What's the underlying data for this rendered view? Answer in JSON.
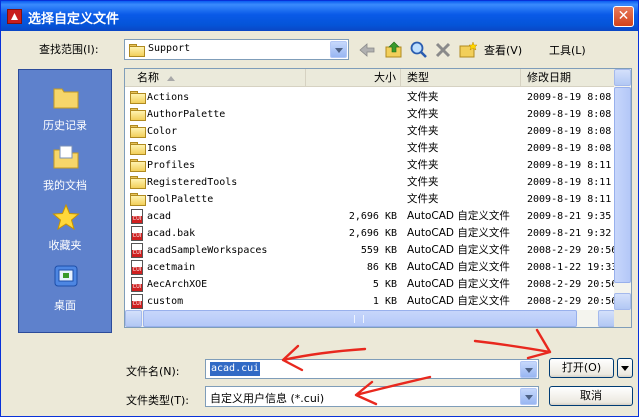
{
  "window": {
    "title": "选择自定义文件"
  },
  "lookin": {
    "label": "查找范围(I):",
    "value": "Support"
  },
  "toolbar": {
    "view_label": "查看(V)",
    "tools_label": "工具(L)"
  },
  "places": [
    {
      "label": "历史记录",
      "icon": "history-folder-icon"
    },
    {
      "label": "我的文档",
      "icon": "documents-folder-icon"
    },
    {
      "label": "收藏夹",
      "icon": "star-icon"
    },
    {
      "label": "桌面",
      "icon": "desktop-icon"
    }
  ],
  "columns": {
    "name": "名称",
    "size": "大小",
    "type": "类型",
    "date": "修改日期"
  },
  "files": [
    {
      "name": "Actions",
      "size": "",
      "type": "文件夹",
      "date": "2009-8-19 8:08",
      "kind": "folder"
    },
    {
      "name": "AuthorPalette",
      "size": "",
      "type": "文件夹",
      "date": "2009-8-19 8:08",
      "kind": "folder"
    },
    {
      "name": "Color",
      "size": "",
      "type": "文件夹",
      "date": "2009-8-19 8:08",
      "kind": "folder"
    },
    {
      "name": "Icons",
      "size": "",
      "type": "文件夹",
      "date": "2009-8-19 8:08",
      "kind": "folder"
    },
    {
      "name": "Profiles",
      "size": "",
      "type": "文件夹",
      "date": "2009-8-19 8:11",
      "kind": "folder"
    },
    {
      "name": "RegisteredTools",
      "size": "",
      "type": "文件夹",
      "date": "2009-8-19 8:11",
      "kind": "folder"
    },
    {
      "name": "ToolPalette",
      "size": "",
      "type": "文件夹",
      "date": "2009-8-19 8:11",
      "kind": "folder"
    },
    {
      "name": "acad",
      "size": "2,696 KB",
      "type": "AutoCAD 自定义文件",
      "date": "2009-8-21 9:35",
      "kind": "cui"
    },
    {
      "name": "acad.bak",
      "size": "2,696 KB",
      "type": "AutoCAD 自定义文件",
      "date": "2009-8-21 9:32",
      "kind": "cui"
    },
    {
      "name": "acadSampleWorkspaces",
      "size": "559 KB",
      "type": "AutoCAD 自定义文件",
      "date": "2008-2-29 20:56",
      "kind": "cui"
    },
    {
      "name": "acetmain",
      "size": "86 KB",
      "type": "AutoCAD 自定义文件",
      "date": "2008-1-22 19:33",
      "kind": "cui"
    },
    {
      "name": "AecArchXOE",
      "size": "5 KB",
      "type": "AutoCAD 自定义文件",
      "date": "2008-2-29 20:56",
      "kind": "cui"
    },
    {
      "name": "custom",
      "size": "1 KB",
      "type": "AutoCAD 自定义文件",
      "date": "2008-2-29 20:56",
      "kind": "cui"
    }
  ],
  "filename": {
    "label": "文件名(N):",
    "value": "acad.cui"
  },
  "filetype": {
    "label": "文件类型(T):",
    "value": "自定义用户信息 (*.cui)"
  },
  "buttons": {
    "open": "打开(O)",
    "cancel": "取消"
  },
  "annotation_color": "#e8281e"
}
